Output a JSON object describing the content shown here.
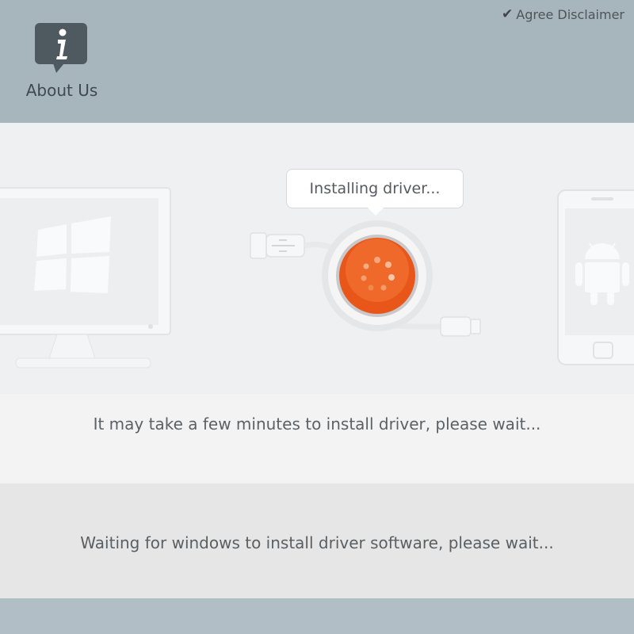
{
  "header": {
    "about_label": "About Us",
    "disclaimer_label": "Agree Disclaimer"
  },
  "stage": {
    "bubble_text": "Installing driver...",
    "icons": [
      "computer-monitor-icon",
      "windows-logo-icon",
      "usb-plug-icon",
      "loading-spinner-icon",
      "usb-connector-icon",
      "smartphone-icon",
      "android-robot-icon"
    ]
  },
  "band": {
    "message": "It may take a few minutes to install driver, please wait..."
  },
  "status": {
    "message": "Waiting for windows to install driver software, please wait..."
  },
  "colors": {
    "header_bg": "#a7b5bd",
    "accent_orange": "#e8561a",
    "footer_bg": "#b2bec5"
  }
}
